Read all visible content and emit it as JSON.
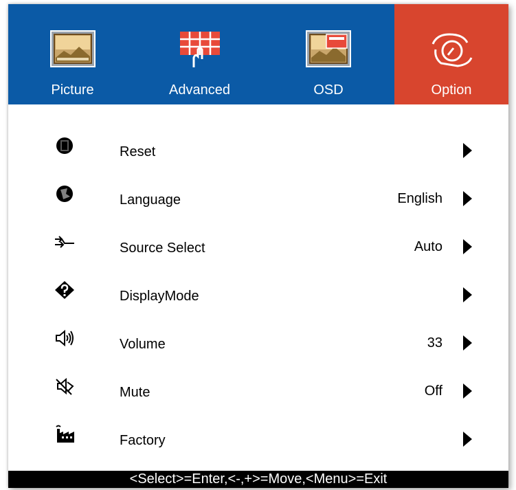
{
  "tabs": [
    {
      "label": "Picture",
      "icon": "picture-icon",
      "active": false
    },
    {
      "label": "Advanced",
      "icon": "advanced-grid-icon",
      "active": false
    },
    {
      "label": "OSD",
      "icon": "osd-icon",
      "active": false
    },
    {
      "label": "Option",
      "icon": "option-hand-icon",
      "active": true
    }
  ],
  "menu": {
    "items": [
      {
        "label": "Reset",
        "value": "",
        "icon": "reset-icon"
      },
      {
        "label": "Language",
        "value": "English",
        "icon": "language-icon"
      },
      {
        "label": "Source Select",
        "value": "Auto",
        "icon": "source-select-icon"
      },
      {
        "label": "DisplayMode",
        "value": "",
        "icon": "display-mode-icon"
      },
      {
        "label": "Volume",
        "value": "33",
        "icon": "volume-icon"
      },
      {
        "label": "Mute",
        "value": "Off",
        "icon": "mute-icon"
      },
      {
        "label": "Factory",
        "value": "",
        "icon": "factory-icon"
      }
    ]
  },
  "footer": {
    "hint": "<Select>=Enter,<-,+>=Move,<Menu>=Exit"
  },
  "colors": {
    "tabbar": "#0b5aa6",
    "active_tab": "#d8452e",
    "footer": "#000000"
  }
}
